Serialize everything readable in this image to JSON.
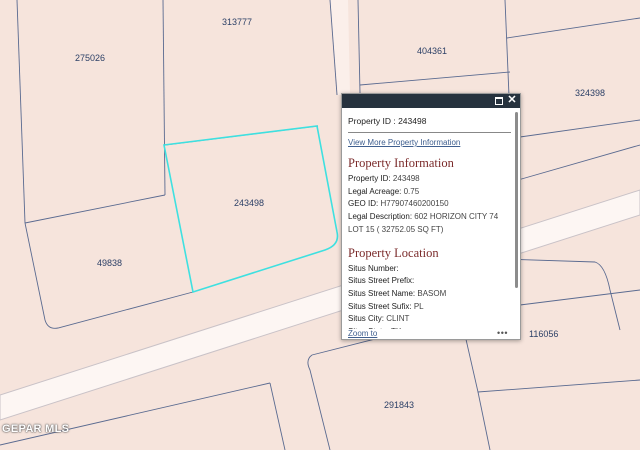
{
  "map": {
    "parcels": [
      {
        "id": "313777"
      },
      {
        "id": "275026"
      },
      {
        "id": "404361"
      },
      {
        "id": "324398"
      },
      {
        "id": "243498"
      },
      {
        "id": "49838"
      },
      {
        "id": "116056"
      },
      {
        "id": "291843"
      }
    ],
    "colors": {
      "land": "#f6e4dc",
      "parcel_line": "#5a6a90",
      "road": "#ffffff",
      "highlight": "#3ee0e0"
    },
    "watermark": "GEPAR MLS"
  },
  "popup": {
    "header": "Property ID : 243498",
    "view_more_link": "View More Property Information",
    "property_information": {
      "title": "Property Information",
      "fields": [
        {
          "label": "Property ID:",
          "value": "243498"
        },
        {
          "label": "Legal Acreage:",
          "value": "0.75"
        },
        {
          "label": "GEO ID:",
          "value": "H77907460200150"
        },
        {
          "label": "Legal Description:",
          "value": "602 HORIZON CITY 74"
        },
        {
          "label": "",
          "value": "LOT 15 ( 32752.05 SQ FT)"
        }
      ]
    },
    "property_location": {
      "title": "Property Location",
      "fields": [
        {
          "label": "Situs Number:",
          "value": ""
        },
        {
          "label": "Situs Street Prefix:",
          "value": ""
        },
        {
          "label": "Situs Street Name:",
          "value": "BASOM"
        },
        {
          "label": "Situs Street Sufix:",
          "value": "PL"
        },
        {
          "label": "Situs City:",
          "value": "CLINT"
        },
        {
          "label": "Situs State:",
          "value": "TX"
        }
      ]
    },
    "zoom_to": "Zoom to",
    "more_icon": "ellipsis-icon",
    "more_label": "•••",
    "maximize_icon": "maximize-icon",
    "close_icon": "close-icon",
    "close_label": "✕"
  }
}
